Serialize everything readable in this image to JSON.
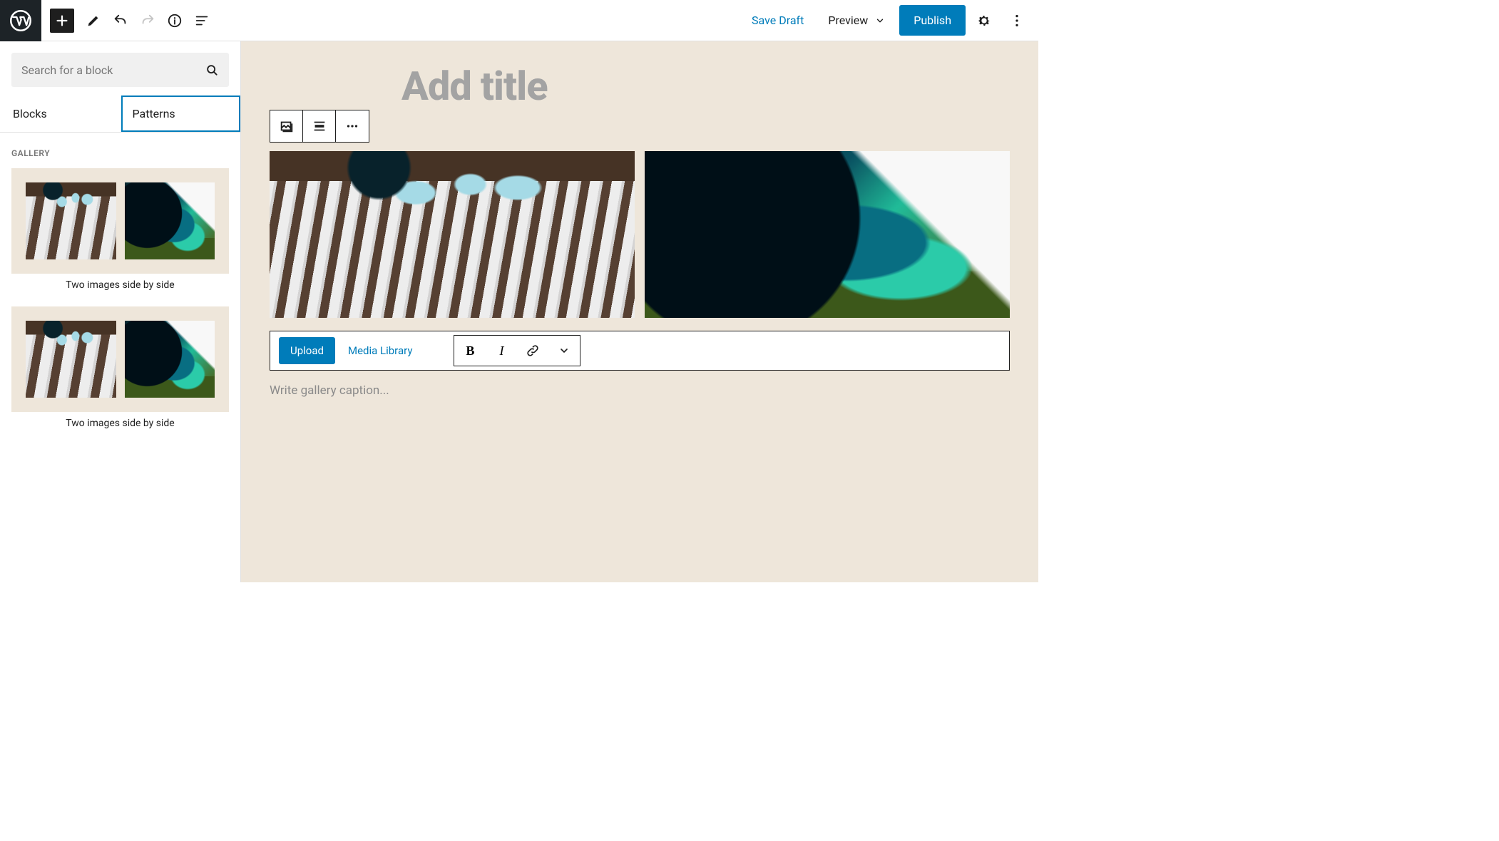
{
  "topbar": {
    "save_draft": "Save Draft",
    "preview": "Preview",
    "publish": "Publish"
  },
  "sidebar": {
    "search_placeholder": "Search for a block",
    "tabs": {
      "blocks": "Blocks",
      "patterns": "Patterns"
    },
    "section_title": "Gallery",
    "patterns": [
      {
        "caption": "Two images side by side"
      },
      {
        "caption": "Two images side by side"
      }
    ]
  },
  "editor": {
    "title_placeholder": "Add title",
    "upload": "Upload",
    "media_library": "Media Library",
    "caption_placeholder": "Write gallery caption..."
  },
  "colors": {
    "accent": "#007cba",
    "canvas": "#eee6da"
  }
}
